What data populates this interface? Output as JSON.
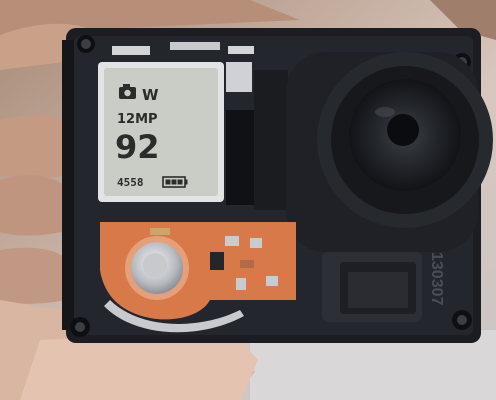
{
  "lcd": {
    "mode_icon": "camera-icon",
    "mode_letter": "W",
    "resolution": "12MP",
    "shots_remaining": "92",
    "counter": "4558",
    "battery_icon": "battery-icon"
  },
  "serial_label": "130307",
  "colors": {
    "lcd_background": "#c9cdc6",
    "lcd_text": "#2a2d2a",
    "housing": "#1b1d22",
    "flex_pcb": "#d8794a",
    "skin": "#c69a82",
    "screw_metal": "#d2d4d6"
  }
}
